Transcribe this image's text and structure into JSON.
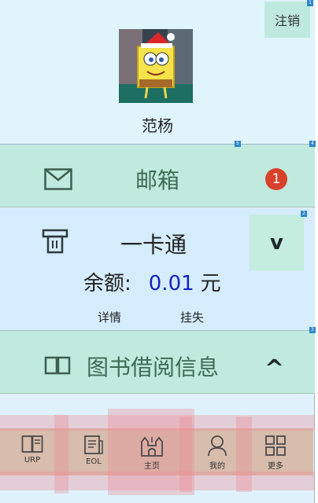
{
  "profile": {
    "logout_label": "注销",
    "username": "范杨"
  },
  "mail": {
    "label": "邮箱",
    "unread_count": "1"
  },
  "card": {
    "title": "一卡通",
    "balance_label": "余额:",
    "balance_value": "0.01",
    "balance_unit": "元",
    "details_link": "详情",
    "report_loss_link": "挂失",
    "toggle_symbol": "v"
  },
  "books": {
    "label": "图书借阅信息",
    "caret_symbol": "^"
  },
  "nav": {
    "items": [
      {
        "label": "URP",
        "icon": "book-open-icon"
      },
      {
        "label": "EOL",
        "icon": "document-icon"
      },
      {
        "label": "主页",
        "icon": "castle-icon"
      },
      {
        "label": "我的",
        "icon": "person-icon"
      },
      {
        "label": "更多",
        "icon": "grid-icon"
      }
    ]
  },
  "debug_markers": [
    "1",
    "5",
    "4",
    "2",
    "3"
  ]
}
